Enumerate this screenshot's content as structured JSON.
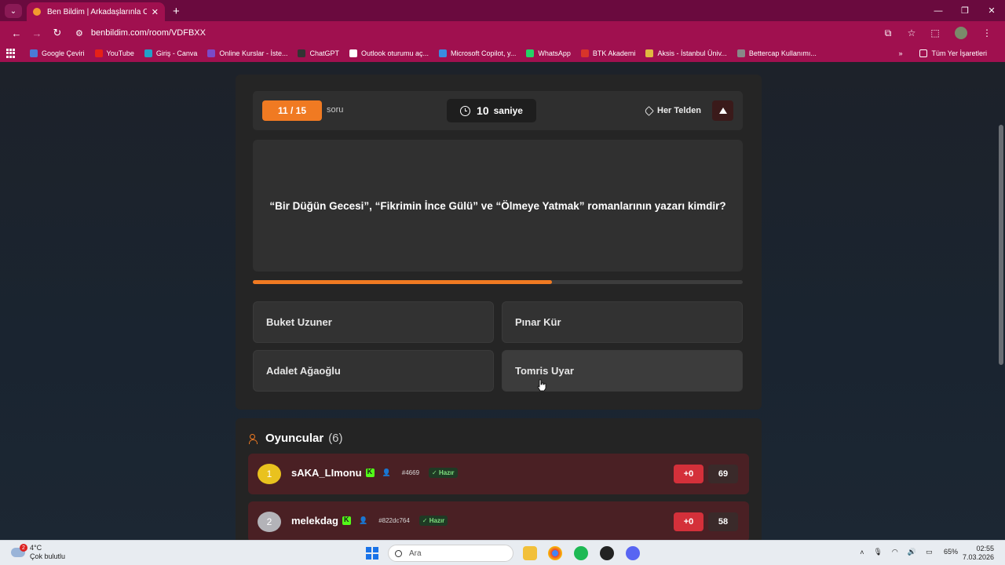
{
  "browser": {
    "tab_title": "Ben Bildim | Arkadaşlarınla Onli",
    "url": "benbildim.com/room/VDFBXX",
    "bookmarks": [
      {
        "label": "Google Çeviri",
        "color": "#4a7bd8"
      },
      {
        "label": "YouTube",
        "color": "#e62117"
      },
      {
        "label": "Giriş - Canva",
        "color": "#22a0c8"
      },
      {
        "label": "Online Kurslar - İste...",
        "color": "#7b4ac8"
      },
      {
        "label": "ChatGPT",
        "color": "#333333"
      },
      {
        "label": "Outlook oturumu aç...",
        "color": "#ffffff"
      },
      {
        "label": "Microsoft Copilot, y...",
        "color": "#3a8ce0"
      },
      {
        "label": "WhatsApp",
        "color": "#25d366"
      },
      {
        "label": "BTK Akademi",
        "color": "#d8342a"
      },
      {
        "label": "Aksis - İstanbul Üniv...",
        "color": "#e0b840"
      },
      {
        "label": "Bettercap Kullanımı...",
        "color": "#888888"
      }
    ],
    "all_bookmarks": "Tüm Yer İşaretleri"
  },
  "game": {
    "question_counter": "11 / 15",
    "question_label": "soru",
    "timer_value": "10",
    "timer_unit": "saniye",
    "category": "Her Telden",
    "question": "“Bir Düğün Gecesi”, “Fikrimin İnce Gülü” ve “Ölmeye Yatmak” romanlarının yazarı kimdir?",
    "progress": 0.61,
    "answers": [
      "Buket Uzuner",
      "Pınar Kür",
      "Adalet Ağaoğlu",
      "Tomris Uyar"
    ]
  },
  "players": {
    "title": "Oyuncular",
    "count": "(6)",
    "list": [
      {
        "rank": "1",
        "name": "sAKA_LImonu",
        "tag": "#4669",
        "status": "Hazır",
        "delta": "+0",
        "score": "69"
      },
      {
        "rank": "2",
        "name": "melekdag",
        "tag": "#822dc764",
        "status": "Hazır",
        "delta": "+0",
        "score": "58"
      }
    ]
  },
  "taskbar": {
    "weather_temp": "4°C",
    "weather_desc": "Çok bulutlu",
    "weather_badge": "2",
    "search_placeholder": "Ara",
    "battery": "65%",
    "time": "02:55",
    "date": "7.03.2026"
  }
}
